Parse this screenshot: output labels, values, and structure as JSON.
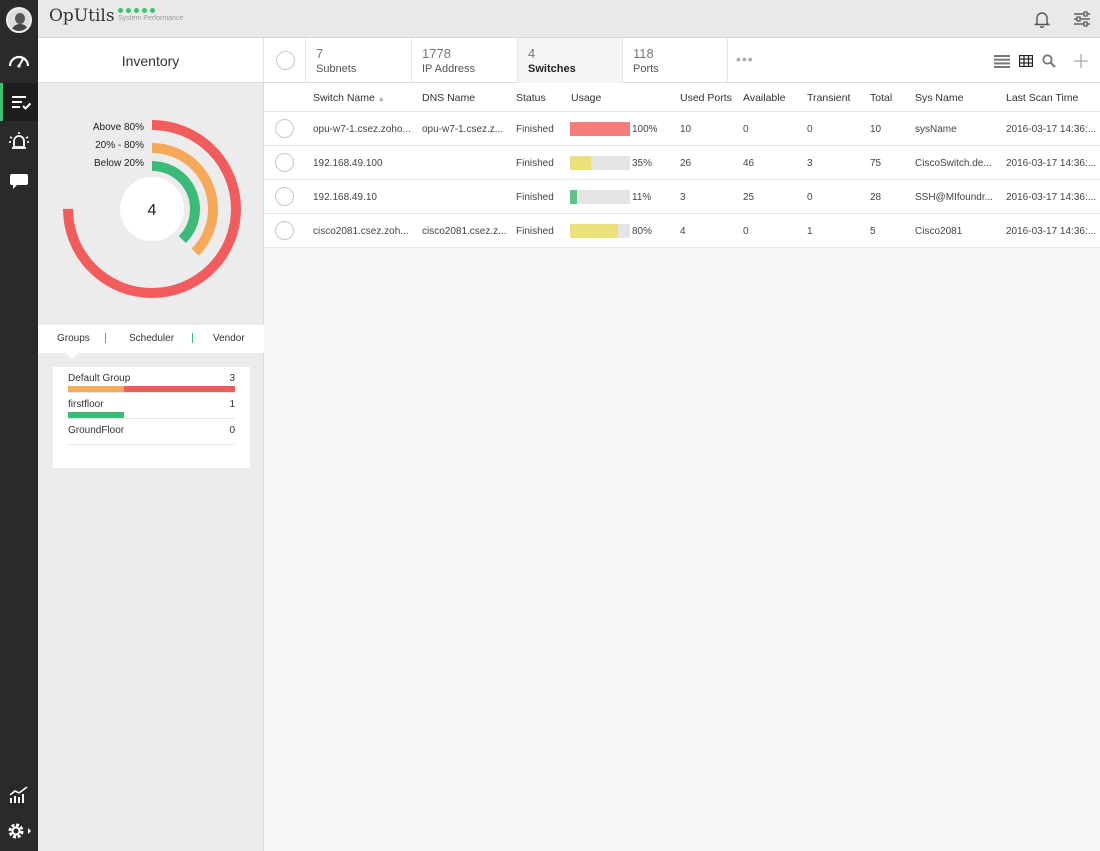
{
  "app": {
    "title": "OpUtils",
    "perf_label": "System Performance",
    "perf_dot_color": "#3ac26e"
  },
  "rail_icons": [
    "avatar",
    "dashboard-icon",
    "inventory-icon",
    "alarm-icon",
    "chat-icon",
    "reports-icon",
    "settings-icon"
  ],
  "summary": {
    "title": "Inventory",
    "stats": [
      {
        "value": "7",
        "label": "Subnets"
      },
      {
        "value": "1778",
        "label": "IP Address"
      },
      {
        "value": "4",
        "label": "Switches"
      },
      {
        "value": "118",
        "label": "Ports"
      }
    ],
    "selected_stat": "Switches",
    "more": "•••"
  },
  "donut": {
    "center_value": "4",
    "legend": [
      {
        "label": "Above 80%",
        "color": "#f25c5c"
      },
      {
        "label": "20% - 80%",
        "color": "#f5a959"
      },
      {
        "label": "Below 20%",
        "color": "#3cba78"
      }
    ]
  },
  "group_tabs": [
    "Groups",
    "Scheduler",
    "Vendor"
  ],
  "groups": [
    {
      "name": "Default Group",
      "count": "3"
    },
    {
      "name": "firstfloor",
      "count": "1"
    },
    {
      "name": "GroundFloor",
      "count": "0"
    }
  ],
  "table": {
    "columns": [
      "Switch Name",
      "DNS Name",
      "Status",
      "Usage",
      "Used Ports",
      "Available",
      "Transient",
      "Total",
      "Sys Name",
      "Last Scan Time"
    ],
    "rows": [
      {
        "switch": "opu-w7-1.csez.zoho...",
        "dns": "opu-w7-1.csez.z...",
        "status": "Finished",
        "usage": 100,
        "usage_label": "100%",
        "usage_color": "#f77b7b",
        "used": "10",
        "available": "0",
        "transient": "0",
        "total": "10",
        "sys": "sysName",
        "scan": "2016-03-17 14:36:..."
      },
      {
        "switch": "192.168.49.100",
        "dns": "",
        "status": "Finished",
        "usage": 35,
        "usage_label": "35%",
        "usage_color": "#ebe07a",
        "used": "26",
        "available": "46",
        "transient": "3",
        "total": "75",
        "sys": "CiscoSwitch.de...",
        "scan": "2016-03-17 14:36:..."
      },
      {
        "switch": "192.168.49.10",
        "dns": "",
        "status": "Finished",
        "usage": 11,
        "usage_label": "11%",
        "usage_color": "#5cc48a",
        "used": "3",
        "available": "25",
        "transient": "0",
        "total": "28",
        "sys": "SSH@MIfoundr...",
        "scan": "2016-03-17 14:36:..."
      },
      {
        "switch": "cisco2081.csez.zoh...",
        "dns": "cisco2081.csez.z...",
        "status": "Finished",
        "usage": 80,
        "usage_label": "80%",
        "usage_color": "#ebe07a",
        "used": "4",
        "available": "0",
        "transient": "1",
        "total": "5",
        "sys": "Cisco2081",
        "scan": "2016-03-17 14:36:..."
      }
    ]
  }
}
